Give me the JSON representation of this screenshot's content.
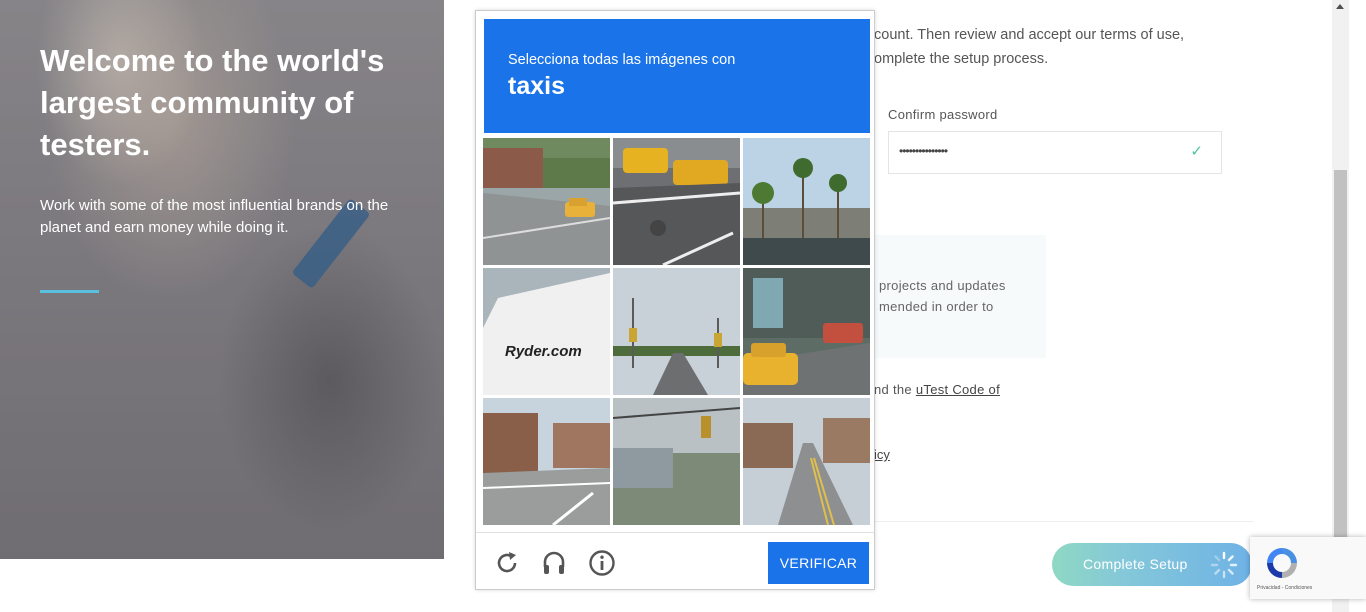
{
  "hero": {
    "title": "Welcome to the world's largest community of testers.",
    "subtitle": "Work with some of the most influential brands on the planet and earn money while doing it."
  },
  "form": {
    "intro_line1": "count. Then review and accept our terms of use,",
    "intro_line2": "omplete the setup process.",
    "confirm_password_label": "Confirm password",
    "confirm_password_value": "•••••••••••••••",
    "info_line1": "projects and updates",
    "info_line2": "mended in order to",
    "terms_prefix": "nd the ",
    "terms_link": "uTest Code of",
    "policy_link": "icy",
    "complete_button": "Complete Setup"
  },
  "captcha": {
    "instruction": "Selecciona todas las imágenes con",
    "target": "taxis",
    "verify_button": "VERIFICAR",
    "icons": [
      "reload-icon",
      "audio-icon",
      "info-icon"
    ]
  },
  "recaptcha_badge": {
    "legal": "Privacidad - Condiciones"
  },
  "colors": {
    "captcha_blue": "#1a73e8",
    "accent_teal": "#4cc6a2",
    "hero_line": "#5bc0de"
  }
}
